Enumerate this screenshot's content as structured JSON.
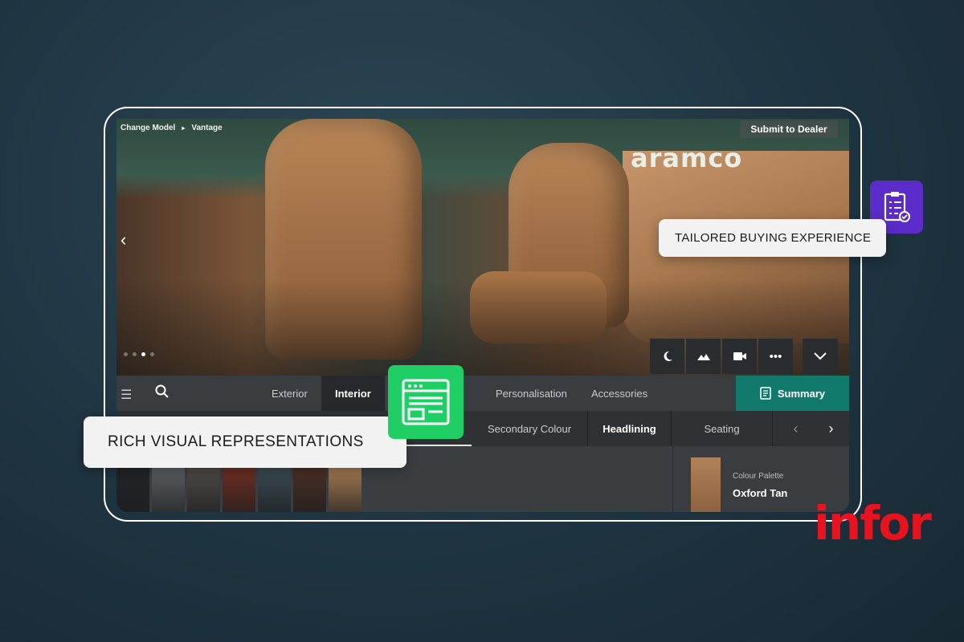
{
  "viewer": {
    "breadcrumb": [
      "Change Model",
      "Vantage"
    ],
    "breadcrumb_separator": "▸",
    "submit_label": "Submit to Dealer",
    "brand_sign": "aramco",
    "carousel_dots": 4,
    "carousel_active": 3,
    "tools": [
      "night-mode",
      "scenery",
      "video",
      "more",
      "collapse"
    ]
  },
  "nav": {
    "tabs": [
      "Exterior",
      "Interior",
      "Personalisation",
      "Accessories"
    ],
    "active_tab": "Interior",
    "summary_label": "Summary"
  },
  "subnav": {
    "tabs": [
      "Secondary Colour",
      "Headlining",
      "Seating"
    ]
  },
  "panel": {
    "swatch_colors": [
      "#222428",
      "#5c6063",
      "#4d4a47",
      "#6e2e22",
      "#3a4a52",
      "#4a2f25",
      "#a67a52"
    ],
    "detail_label": "Colour Palette",
    "detail_value": "Oxford Tan"
  },
  "callouts": {
    "right": "TAILORED BUYING EXPERIENCE",
    "left": "RICH VISUAL REPRESENTATIONS"
  },
  "logo": "infor",
  "colors": {
    "accent_teal": "#117a6c",
    "badge_purple": "#5b2cc9",
    "badge_green": "#1fcf66",
    "logo_red": "#e8131f"
  }
}
